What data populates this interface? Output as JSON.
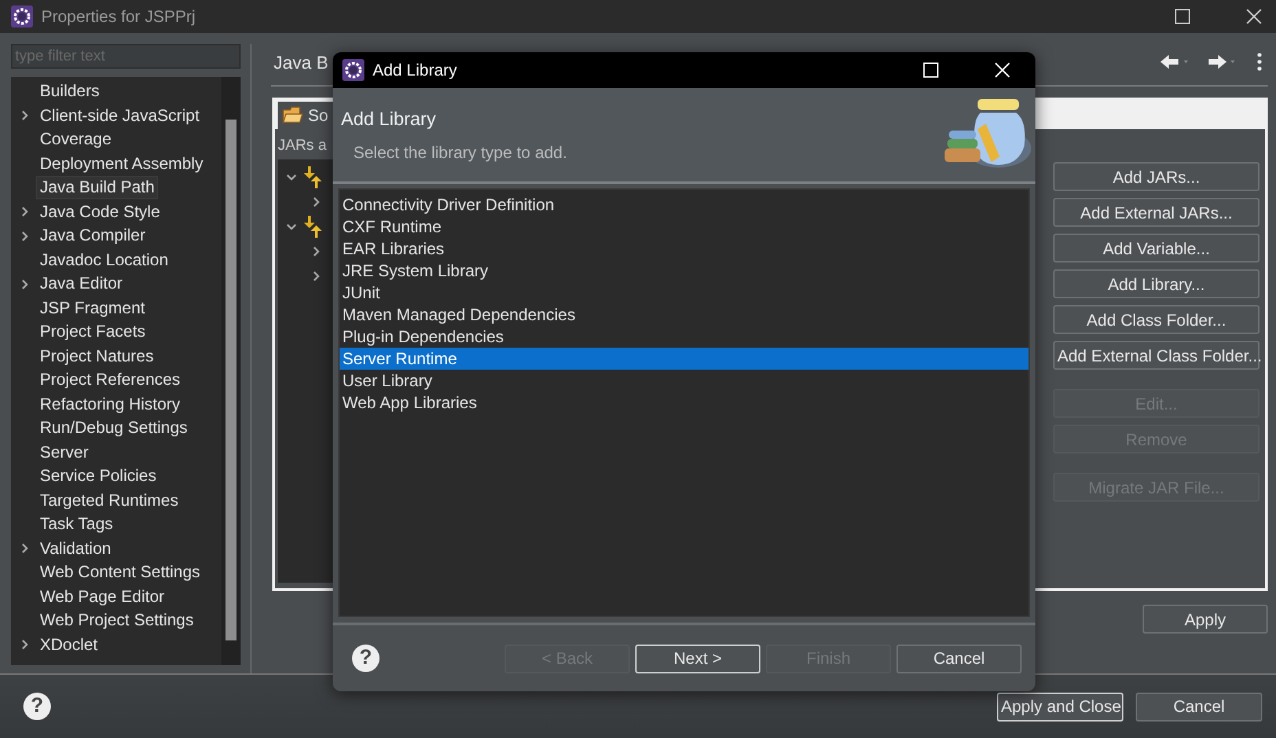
{
  "window": {
    "title": "Properties for JSPPrj"
  },
  "filter": {
    "placeholder": "type filter text"
  },
  "help_icon": "?",
  "property_pages": [
    {
      "label": "Builders",
      "expandable": false,
      "selected": false
    },
    {
      "label": "Client-side JavaScript",
      "expandable": true,
      "selected": false
    },
    {
      "label": "Coverage",
      "expandable": false,
      "selected": false
    },
    {
      "label": "Deployment Assembly",
      "expandable": false,
      "selected": false
    },
    {
      "label": "Java Build Path",
      "expandable": false,
      "selected": true
    },
    {
      "label": "Java Code Style",
      "expandable": true,
      "selected": false
    },
    {
      "label": "Java Compiler",
      "expandable": true,
      "selected": false
    },
    {
      "label": "Javadoc Location",
      "expandable": false,
      "selected": false
    },
    {
      "label": "Java Editor",
      "expandable": true,
      "selected": false
    },
    {
      "label": "JSP Fragment",
      "expandable": false,
      "selected": false
    },
    {
      "label": "Project Facets",
      "expandable": false,
      "selected": false
    },
    {
      "label": "Project Natures",
      "expandable": false,
      "selected": false
    },
    {
      "label": "Project References",
      "expandable": false,
      "selected": false
    },
    {
      "label": "Refactoring History",
      "expandable": false,
      "selected": false
    },
    {
      "label": "Run/Debug Settings",
      "expandable": false,
      "selected": false
    },
    {
      "label": "Server",
      "expandable": false,
      "selected": false
    },
    {
      "label": "Service Policies",
      "expandable": false,
      "selected": false
    },
    {
      "label": "Targeted Runtimes",
      "expandable": false,
      "selected": false
    },
    {
      "label": "Task Tags",
      "expandable": false,
      "selected": false
    },
    {
      "label": "Validation",
      "expandable": true,
      "selected": false
    },
    {
      "label": "Web Content Settings",
      "expandable": false,
      "selected": false
    },
    {
      "label": "Web Page Editor",
      "expandable": false,
      "selected": false
    },
    {
      "label": "Web Project Settings",
      "expandable": false,
      "selected": false
    },
    {
      "label": "XDoclet",
      "expandable": true,
      "selected": false
    }
  ],
  "page": {
    "title": "Java B",
    "tabs": [
      {
        "label": "So",
        "selected": true
      }
    ],
    "section_label": "JARs a",
    "build_path_tree": [
      {
        "expanded": true,
        "children": [
          {
            "expanded": false
          }
        ]
      },
      {
        "expanded": true,
        "children": [
          {
            "expanded": false
          },
          {
            "expanded": false
          }
        ]
      }
    ],
    "button_groups": [
      [
        {
          "label": "Add JARs...",
          "disabled": false
        },
        {
          "label": "Add External JARs...",
          "disabled": false
        },
        {
          "label": "Add Variable...",
          "disabled": false
        },
        {
          "label": "Add Library...",
          "disabled": false
        },
        {
          "label": "Add Class Folder...",
          "disabled": false
        },
        {
          "label": "Add External Class Folder...",
          "disabled": false
        }
      ],
      [
        {
          "label": "Edit...",
          "disabled": true
        },
        {
          "label": "Remove",
          "disabled": true
        }
      ],
      [
        {
          "label": "Migrate JAR File...",
          "disabled": true
        }
      ]
    ],
    "apply_button": "Apply"
  },
  "footer_buttons": [
    {
      "label": "Apply and Close",
      "default": true
    },
    {
      "label": "Cancel",
      "default": false
    }
  ],
  "dialog": {
    "title": "Add Library",
    "help_icon": "?",
    "heading": "Add Library",
    "description": "Select the library type to add.",
    "library_types": [
      {
        "label": "Connectivity Driver Definition",
        "selected": false
      },
      {
        "label": "CXF Runtime",
        "selected": false
      },
      {
        "label": "EAR Libraries",
        "selected": false
      },
      {
        "label": "JRE System Library",
        "selected": false
      },
      {
        "label": "JUnit",
        "selected": false
      },
      {
        "label": "Maven Managed Dependencies",
        "selected": false
      },
      {
        "label": "Plug-in Dependencies",
        "selected": false
      },
      {
        "label": "Server Runtime",
        "selected": true
      },
      {
        "label": "User Library",
        "selected": false
      },
      {
        "label": "Web App Libraries",
        "selected": false
      }
    ],
    "buttons": [
      {
        "label": "< Back",
        "disabled": true,
        "default": false
      },
      {
        "label": "Next >",
        "disabled": false,
        "default": true
      },
      {
        "label": "Finish",
        "disabled": true,
        "default": false
      },
      {
        "label": "Cancel",
        "disabled": false,
        "default": false
      }
    ]
  }
}
